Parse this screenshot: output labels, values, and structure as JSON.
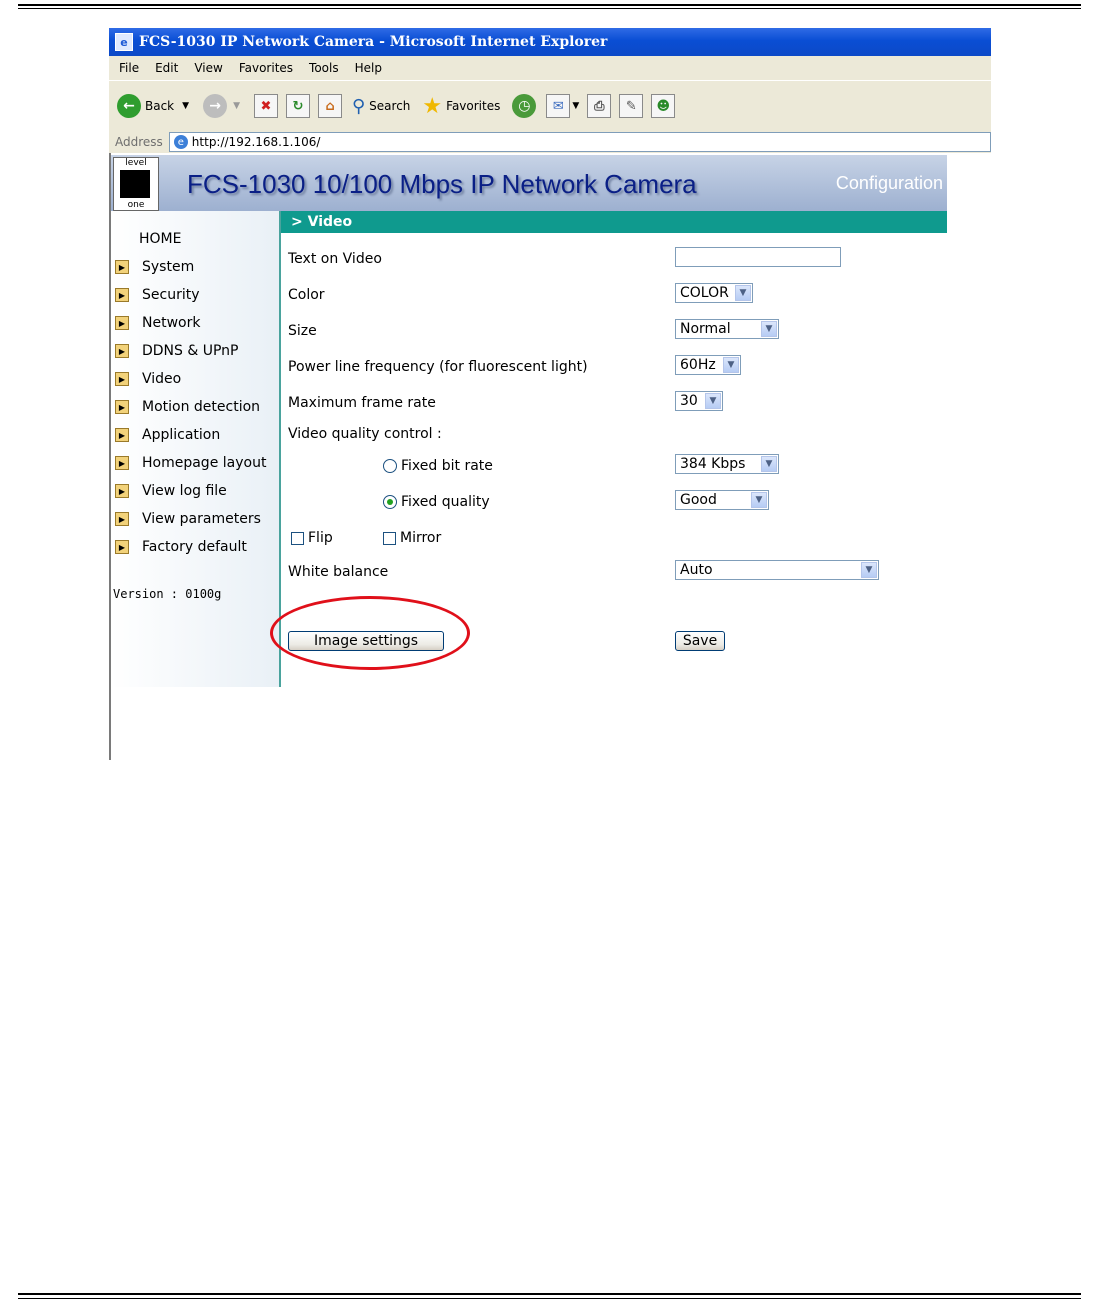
{
  "window": {
    "title": "FCS-1030 IP Network Camera - Microsoft Internet Explorer",
    "menu": [
      "File",
      "Edit",
      "View",
      "Favorites",
      "Tools",
      "Help"
    ],
    "toolbar": {
      "back": "Back",
      "search": "Search",
      "favorites": "Favorites"
    },
    "address_label": "Address",
    "url": "http://192.168.1.106/"
  },
  "banner": {
    "logo_top": "level",
    "logo_bottom": "one",
    "title": "FCS-1030  10/100 Mbps IP Network Camera",
    "config": "Configuration"
  },
  "sidebar": {
    "home": "HOME",
    "items": [
      "System",
      "Security",
      "Network",
      "DDNS & UPnP",
      "Video",
      "Motion detection",
      "Application",
      "Homepage layout",
      "View log file",
      "View parameters",
      "Factory default"
    ],
    "version": "Version : 0100g"
  },
  "main": {
    "section": "> Video",
    "text_on_video": {
      "label": "Text on Video",
      "value": ""
    },
    "color": {
      "label": "Color",
      "value": "COLOR"
    },
    "size": {
      "label": "Size",
      "value": "Normal"
    },
    "power": {
      "label": "Power line frequency (for fluorescent light)",
      "value": "60Hz"
    },
    "framerate": {
      "label": "Maximum frame rate",
      "value": "30"
    },
    "quality_control": "Video quality control :",
    "fixed_bit_rate": {
      "label": "Fixed bit rate",
      "value": "384 Kbps",
      "selected": false
    },
    "fixed_quality": {
      "label": "Fixed quality",
      "value": "Good",
      "selected": true
    },
    "flip": "Flip",
    "mirror": "Mirror",
    "white_balance": {
      "label": "White balance",
      "value": "Auto"
    },
    "image_settings_button": "Image settings",
    "save_button": "Save"
  },
  "colors": {
    "section_header": "#0f9a8e",
    "highlight": "#e0101a",
    "titlebar": "#0a4ed4"
  }
}
